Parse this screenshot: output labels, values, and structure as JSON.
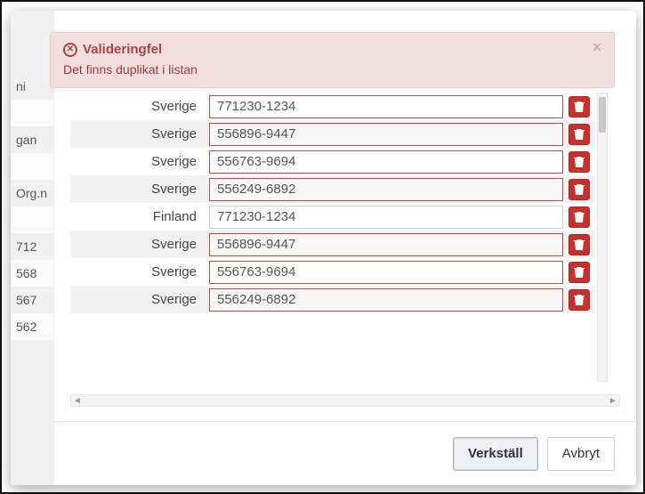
{
  "alert": {
    "title": "Valideringfel",
    "subtitle": "Det finns duplikat i listan"
  },
  "bg_rows": [
    {
      "text": "ni",
      "alt": false
    },
    {
      "text": "",
      "alt": true
    },
    {
      "text": "gan",
      "alt": false
    },
    {
      "text": "",
      "alt": true
    },
    {
      "text": "Org.n",
      "alt": false
    },
    {
      "text": "",
      "alt": true
    },
    {
      "text": "712",
      "alt": false
    },
    {
      "text": "568",
      "alt": true
    },
    {
      "text": "567",
      "alt": false
    },
    {
      "text": "562",
      "alt": true
    }
  ],
  "rows": [
    {
      "country": "Sverige",
      "orgnr": "771230-1234",
      "alt": false,
      "invalid": true
    },
    {
      "country": "Sverige",
      "orgnr": "556896-9447",
      "alt": true,
      "invalid": true
    },
    {
      "country": "Sverige",
      "orgnr": "556763-9694",
      "alt": false,
      "invalid": true
    },
    {
      "country": "Sverige",
      "orgnr": "556249-6892",
      "alt": true,
      "invalid": true
    },
    {
      "country": "Finland",
      "orgnr": "771230-1234",
      "alt": false,
      "invalid": false
    },
    {
      "country": "Sverige",
      "orgnr": "556896-9447",
      "alt": true,
      "invalid": true
    },
    {
      "country": "Sverige",
      "orgnr": "556763-9694",
      "alt": false,
      "invalid": true
    },
    {
      "country": "Sverige",
      "orgnr": "556249-6892",
      "alt": true,
      "invalid": true
    }
  ],
  "footer": {
    "apply": "Verkställ",
    "cancel": "Avbryt"
  }
}
